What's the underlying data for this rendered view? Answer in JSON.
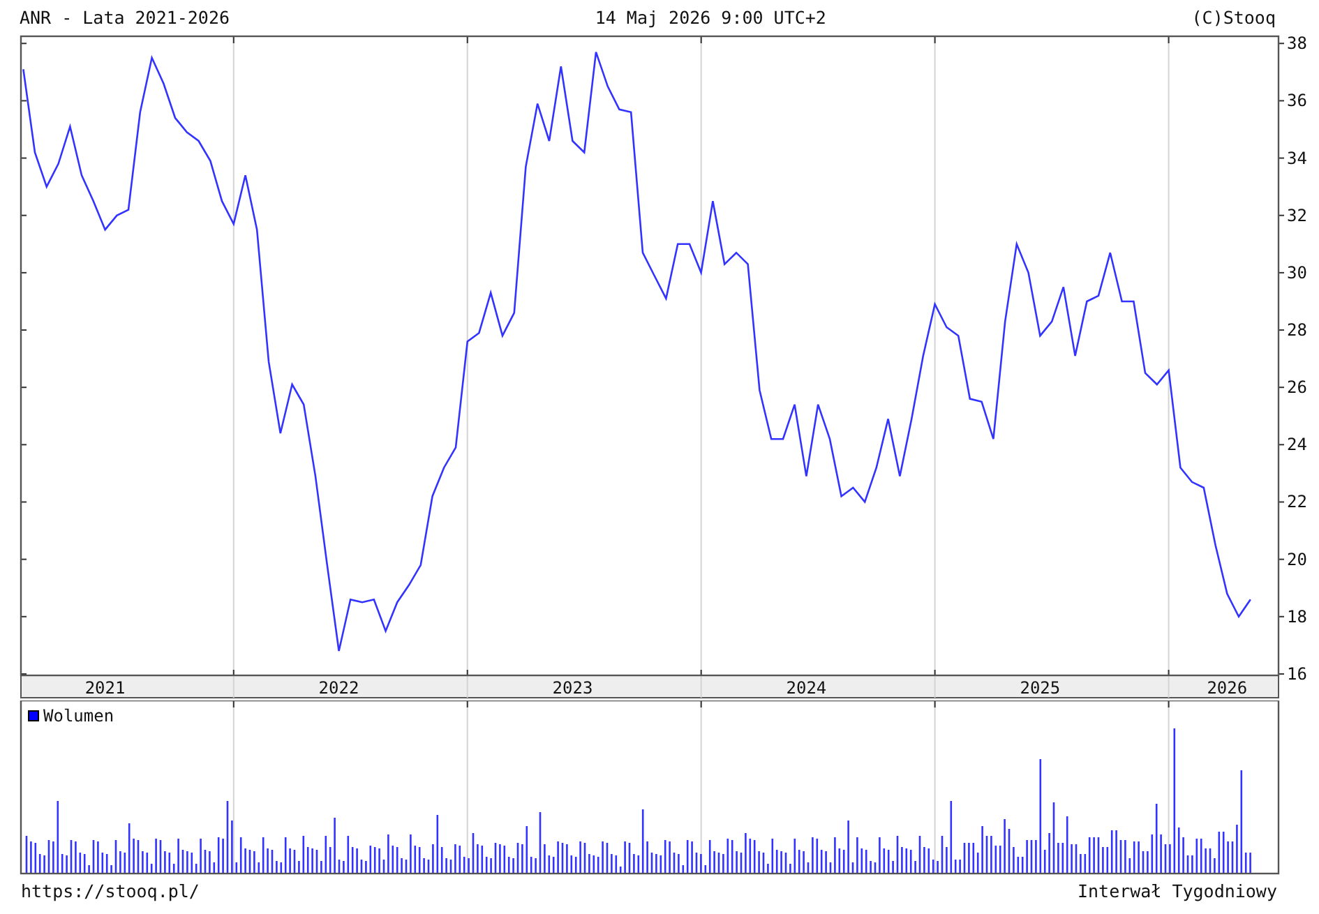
{
  "header": {
    "title": "ANR - Lata 2021-2026",
    "timestamp": "14 Maj 2026 9:00 UTC+2",
    "copyright": "(C)Stooq"
  },
  "price_chart": {
    "chart_data": {
      "type": "line",
      "x": [
        2021.1,
        2021.15,
        2021.2,
        2021.25,
        2021.3,
        2021.35,
        2021.4,
        2021.45,
        2021.5,
        2021.55,
        2021.6,
        2021.65,
        2021.7,
        2021.75,
        2021.8,
        2021.85,
        2021.9,
        2021.95,
        2022.0,
        2022.05,
        2022.1,
        2022.15,
        2022.2,
        2022.25,
        2022.3,
        2022.35,
        2022.4,
        2022.45,
        2022.5,
        2022.55,
        2022.6,
        2022.65,
        2022.7,
        2022.75,
        2022.8,
        2022.85,
        2022.9,
        2022.95,
        2023.0,
        2023.05,
        2023.1,
        2023.15,
        2023.2,
        2023.25,
        2023.3,
        2023.35,
        2023.4,
        2023.45,
        2023.5,
        2023.55,
        2023.6,
        2023.65,
        2023.7,
        2023.75,
        2023.8,
        2023.85,
        2023.9,
        2023.95,
        2024.0,
        2024.05,
        2024.1,
        2024.15,
        2024.2,
        2024.25,
        2024.3,
        2024.35,
        2024.4,
        2024.45,
        2024.5,
        2024.55,
        2024.6,
        2024.65,
        2024.7,
        2024.75,
        2024.8,
        2024.85,
        2024.9,
        2024.95,
        2025.0,
        2025.05,
        2025.1,
        2025.15,
        2025.2,
        2025.25,
        2025.3,
        2025.35,
        2025.4,
        2025.45,
        2025.5,
        2025.55,
        2025.6,
        2025.65,
        2025.7,
        2025.75,
        2025.8,
        2025.85,
        2025.9,
        2025.95,
        2026.0,
        2026.05,
        2026.1,
        2026.15,
        2026.2,
        2026.25,
        2026.3,
        2026.35
      ],
      "series": [
        {
          "color": "#3333ff",
          "values": [
            37.1,
            34.2,
            33.0,
            33.8,
            35.1,
            33.4,
            32.5,
            31.5,
            32.0,
            32.2,
            35.6,
            37.5,
            36.6,
            35.4,
            34.9,
            34.6,
            33.9,
            32.5,
            31.7,
            33.4,
            31.5,
            26.9,
            24.4,
            26.1,
            25.4,
            22.9,
            19.8,
            16.8,
            18.6,
            18.5,
            18.6,
            17.5,
            18.5,
            19.1,
            19.8,
            22.2,
            23.2,
            23.9,
            27.6,
            27.9,
            29.3,
            27.8,
            28.6,
            33.7,
            35.9,
            34.6,
            37.2,
            34.6,
            34.2,
            37.7,
            36.5,
            35.7,
            35.6,
            30.7,
            29.9,
            29.1,
            31.0,
            31.0,
            30.0,
            32.5,
            30.3,
            30.7,
            30.3,
            25.9,
            24.2,
            24.2,
            25.4,
            22.9,
            25.4,
            24.2,
            22.2,
            22.5,
            22.0,
            23.2,
            24.9,
            22.9,
            24.9,
            27.1,
            28.9,
            28.1,
            27.8,
            25.6,
            25.5,
            24.2,
            28.3,
            31.0,
            30.0,
            27.8,
            28.3,
            29.5,
            27.1,
            29.0,
            29.2,
            30.7,
            29.0,
            29.0,
            26.5,
            26.1,
            26.6,
            23.2,
            22.7,
            22.5,
            20.5,
            18.8,
            18.0,
            18.6
          ]
        }
      ],
      "xlim": [
        2021.09,
        2026.47
      ],
      "ylim": [
        15.95,
        38.25
      ],
      "xticks": [
        {
          "value": 2021.45,
          "label": "2021"
        },
        {
          "value": 2022.45,
          "label": "2022"
        },
        {
          "value": 2023.45,
          "label": "2023"
        },
        {
          "value": 2024.45,
          "label": "2024"
        },
        {
          "value": 2025.45,
          "label": "2025"
        },
        {
          "value": 2026.25,
          "label": "2026"
        }
      ],
      "yticks": [
        16,
        18,
        20,
        22,
        24,
        26,
        28,
        30,
        32,
        34,
        36,
        38
      ]
    }
  },
  "volume_panel": {
    "legend": "Wolumen"
  },
  "footer": {
    "url": "https://stooq.pl/",
    "interval": "Interwał Tygodniowy"
  }
}
